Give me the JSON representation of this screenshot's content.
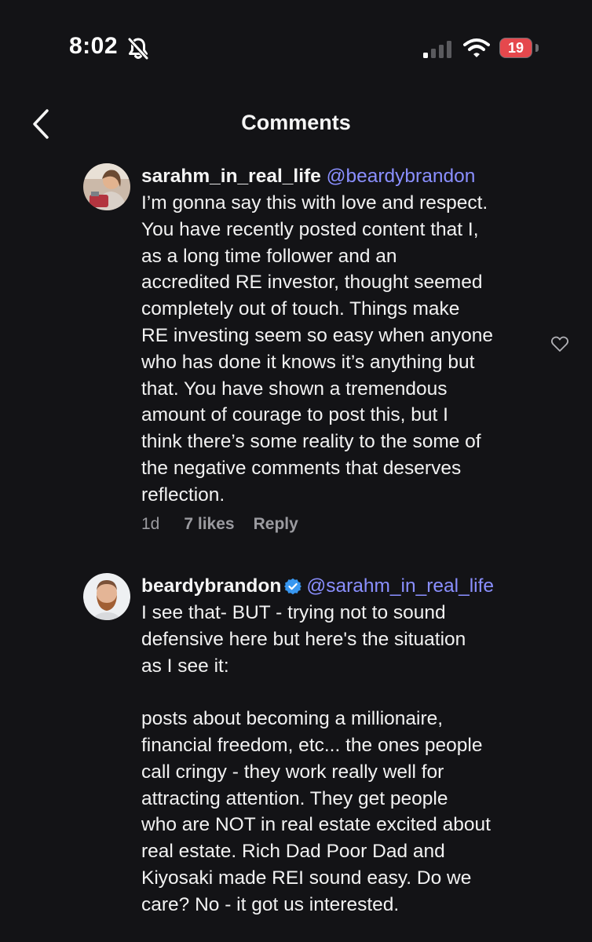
{
  "status_bar": {
    "time": "8:02",
    "battery": "19",
    "icons": [
      "bell-slash-icon",
      "signal-icon",
      "wifi-icon",
      "battery-icon"
    ],
    "battery_color": "#e5484d"
  },
  "header": {
    "title": "Comments",
    "back_icon": "chevron-left-icon"
  },
  "colors": {
    "background": "#131316",
    "mention": "#8a8fff",
    "meta": "#9b9ba0",
    "verified": "#3897f0"
  },
  "comments": [
    {
      "username": "sarahm_in_real_life",
      "mention": "@beardybrandon",
      "text": "I’m gonna say this with love and respect.\nYou have recently posted content that I,\nas a long time follower and an\naccredited RE investor, thought seemed\ncompletely out of touch. Things make\nRE investing seem so easy when anyone\nwho has done it knows it’s anything but\nthat. You have shown a tremendous\namount of courage to post this, but I\nthink there’s some reality to the some of\nthe negative comments that deserves\nreflection.",
      "time": "1d",
      "likes": "7 likes",
      "reply": "Reply"
    },
    {
      "username": "beardybrandon",
      "verified": true,
      "mention": "@sarahm_in_real_life",
      "text": "I see that- BUT - trying not to sound\ndefensive here but here's the situation\nas I see it:\n\nposts about becoming a millionaire,\nfinancial freedom, etc... the ones people\ncall cringy - they work really well for\nattracting attention. They get people\nwho are NOT in real estate excited about\nreal estate. Rich Dad Poor Dad and\nKiyosaki made REI sound easy. Do we\ncare? No - it got us interested."
    }
  ]
}
